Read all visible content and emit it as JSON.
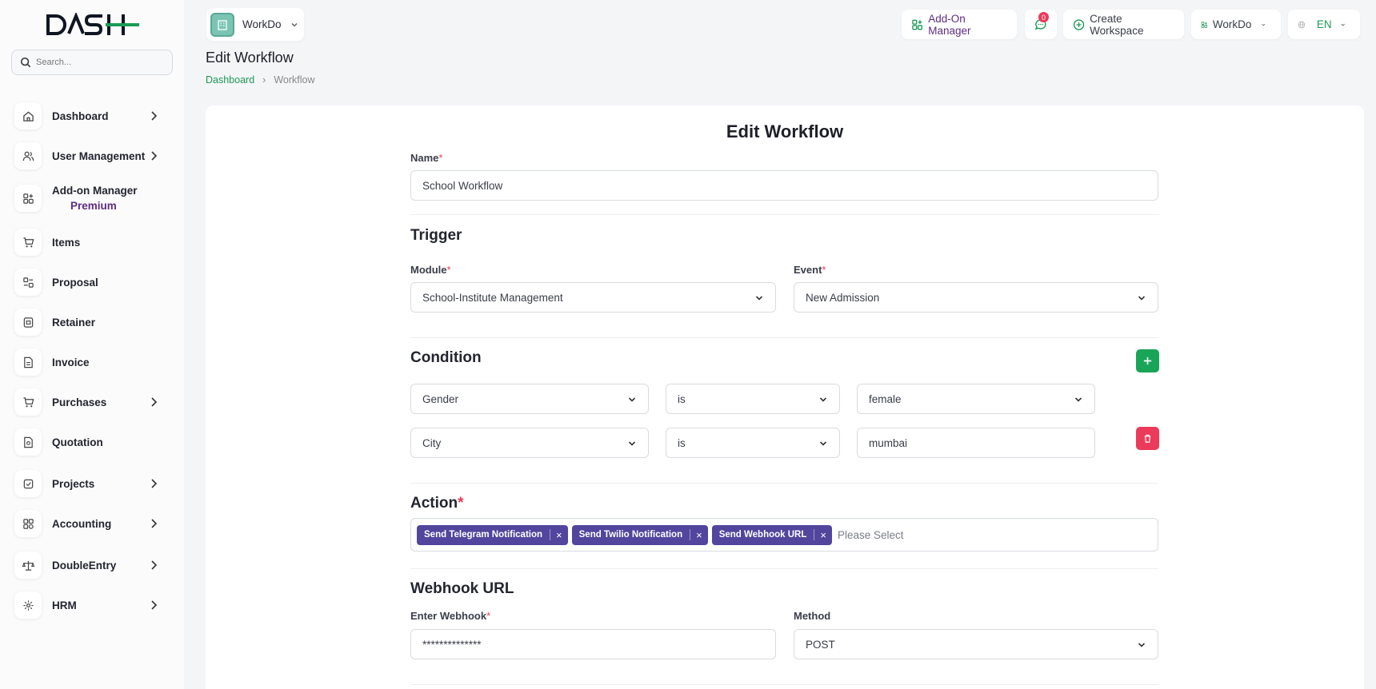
{
  "app": {
    "logo_text": "DASH"
  },
  "search": {
    "placeholder": "Search..."
  },
  "sidebar": {
    "items": [
      {
        "label": "Dashboard",
        "icon": "home-icon",
        "has_submenu": true
      },
      {
        "label": "User Management",
        "icon": "users-icon",
        "has_submenu": true
      },
      {
        "label": "Add-on Manager",
        "icon": "addon-grid-icon",
        "has_submenu": false,
        "badge": "Premium"
      },
      {
        "label": "Items",
        "icon": "cart-icon",
        "has_submenu": false
      },
      {
        "label": "Proposal",
        "icon": "proposal-icon",
        "has_submenu": false
      },
      {
        "label": "Retainer",
        "icon": "retainer-icon",
        "has_submenu": false
      },
      {
        "label": "Invoice",
        "icon": "invoice-icon",
        "has_submenu": false
      },
      {
        "label": "Purchases",
        "icon": "cart-icon",
        "has_submenu": true
      },
      {
        "label": "Quotation",
        "icon": "quotation-icon",
        "has_submenu": false
      },
      {
        "label": "Projects",
        "icon": "projects-icon",
        "has_submenu": true
      },
      {
        "label": "Accounting",
        "icon": "accounting-icon",
        "has_submenu": true
      },
      {
        "label": "DoubleEntry",
        "icon": "scale-icon",
        "has_submenu": true
      },
      {
        "label": "HRM",
        "icon": "hrm-icon",
        "has_submenu": true
      }
    ]
  },
  "header": {
    "workspace": "WorkDo",
    "addon_manager": "Add-On Manager",
    "messages_count": "0",
    "create_workspace": "Create Workspace",
    "workspace_menu": "WorkDo",
    "language": "EN"
  },
  "page": {
    "title": "Edit Workflow",
    "breadcrumb": [
      "Dashboard",
      "Workflow"
    ]
  },
  "form": {
    "title": "Edit Workflow",
    "name_label": "Name",
    "name_value": "School Workflow",
    "trigger_heading": "Trigger",
    "module_label": "Module",
    "module_value": "School-Institute Management",
    "event_label": "Event",
    "event_value": "New Admission",
    "condition_heading": "Condition",
    "conditions": [
      {
        "field": "Gender",
        "operator": "is",
        "value": "female"
      },
      {
        "field": "City",
        "operator": "is",
        "value": "mumbai"
      }
    ],
    "action_heading": "Action",
    "actions": [
      "Send Telegram Notification",
      "Send Twilio Notification",
      "Send Webhook URL"
    ],
    "action_placeholder": "Please Select",
    "webhook_heading": "Webhook URL",
    "webhook_label": "Enter Webhook",
    "webhook_value": "**************",
    "method_label": "Method",
    "method_value": "POST"
  },
  "colors": {
    "brand_green": "#1c9a57",
    "accent_purple": "#51459d",
    "premium_purple": "#5c2b82",
    "danger": "#ec3a5a"
  }
}
